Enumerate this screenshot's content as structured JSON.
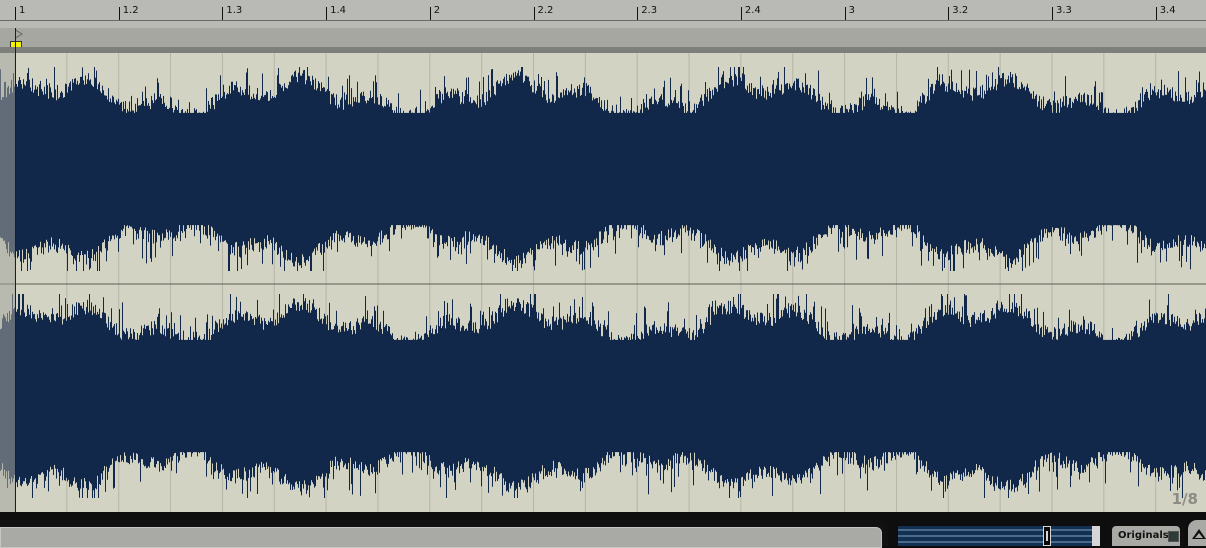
{
  "ruler": {
    "ticks": [
      {
        "label": "1",
        "beat": 0
      },
      {
        "label": "1.2",
        "beat": 1
      },
      {
        "label": "1.3",
        "beat": 2
      },
      {
        "label": "1.4",
        "beat": 3
      },
      {
        "label": "2",
        "beat": 4
      },
      {
        "label": "2.2",
        "beat": 5
      },
      {
        "label": "2.3",
        "beat": 6
      },
      {
        "label": "2.4",
        "beat": 7
      },
      {
        "label": "3",
        "beat": 8
      },
      {
        "label": "3.2",
        "beat": 9
      },
      {
        "label": "3.3",
        "beat": 10
      },
      {
        "label": "3.4",
        "beat": 11
      }
    ]
  },
  "zoom_grid": "1/8",
  "bottom": {
    "originals_label": "Originals",
    "originals_checked": true
  },
  "colors": {
    "waveform": "#12284a",
    "waveform_bg": "#d3d3c3",
    "grid": "#b5b6a8",
    "loop_marker": "#f4f400"
  },
  "icons": {
    "start_marker": "triangle-right-icon",
    "loop_marker": "yellow-square-icon",
    "expand": "triangle-up-icon"
  }
}
